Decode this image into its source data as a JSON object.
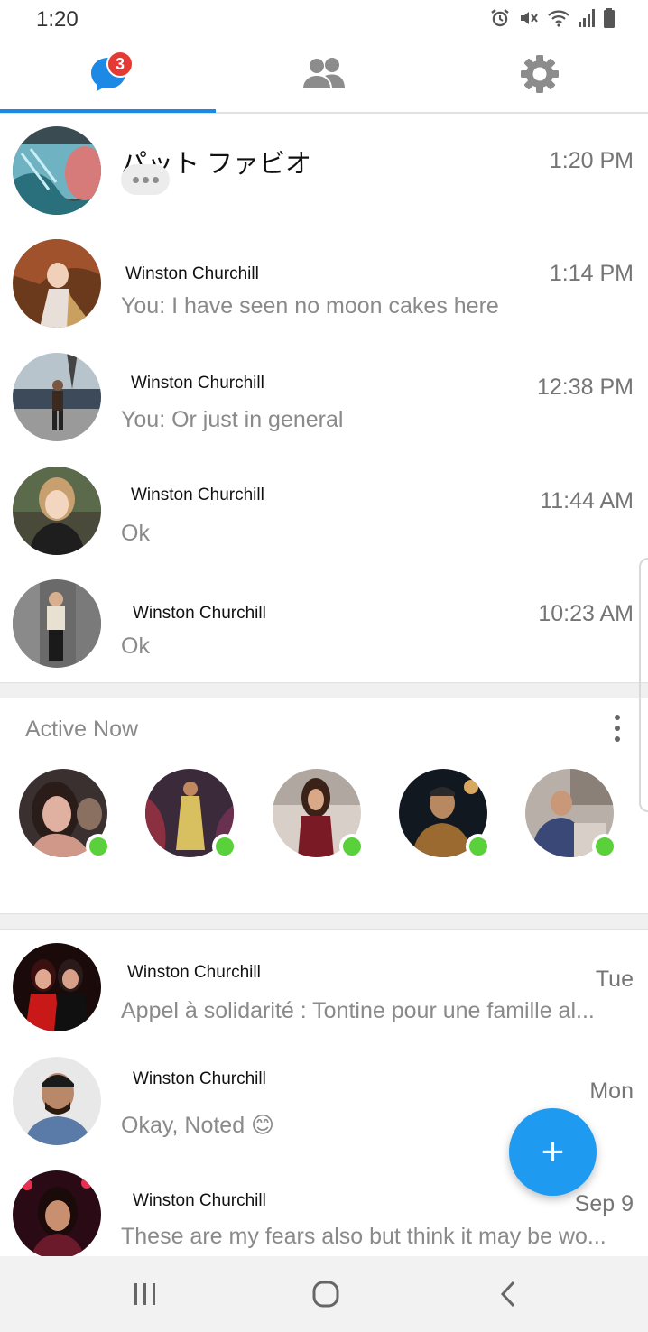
{
  "status_bar": {
    "time": "1:20",
    "icons": [
      "alarm-icon",
      "mute-icon",
      "wifi-icon",
      "signal-icon",
      "battery-icon"
    ]
  },
  "tabs": [
    {
      "name": "chats",
      "icon": "chat-bubble-icon",
      "badge": "3",
      "selected": true
    },
    {
      "name": "people",
      "icon": "people-icon",
      "selected": false
    },
    {
      "name": "settings",
      "icon": "gear-icon",
      "selected": false
    }
  ],
  "conversations_top": [
    {
      "name": "パット ファビオ",
      "time": "1:20 PM",
      "preview": "",
      "typing": true
    },
    {
      "name": "Winston Churchill",
      "time": "1:14 PM",
      "preview": "You: I have seen no moon cakes here"
    },
    {
      "name": "Winston Churchill",
      "time": "12:38 PM",
      "preview": "You: Or just in general"
    },
    {
      "name": "Winston Churchill",
      "time": "11:44 AM",
      "preview": "Ok"
    },
    {
      "name": "Winston Churchill",
      "time": "10:23 AM",
      "preview": "Ok"
    }
  ],
  "active_now": {
    "title": "Active Now",
    "menu_icon": "more-vertical-icon",
    "count": 5
  },
  "conversations_bottom": [
    {
      "name": "Winston Churchill",
      "time": "Tue",
      "preview": "Appel à solidarité : Tontine pour une famille al..."
    },
    {
      "name": "Winston Churchill",
      "time": "Mon",
      "preview": "Okay, Noted 😊"
    },
    {
      "name": "Winston Churchill",
      "time": "Sep 9",
      "preview": "These are my fears also but think it may be wo..."
    }
  ],
  "fab": {
    "label": "+",
    "icon": "plus-icon"
  },
  "nav_bar": {
    "icons": [
      "recent-apps-icon",
      "home-icon",
      "back-icon"
    ]
  },
  "colors": {
    "accent": "#1e88e5",
    "fab": "#1e9bf0",
    "badge": "#e53935",
    "online": "#5ad13a",
    "icon_gray": "#8c8c8c"
  }
}
